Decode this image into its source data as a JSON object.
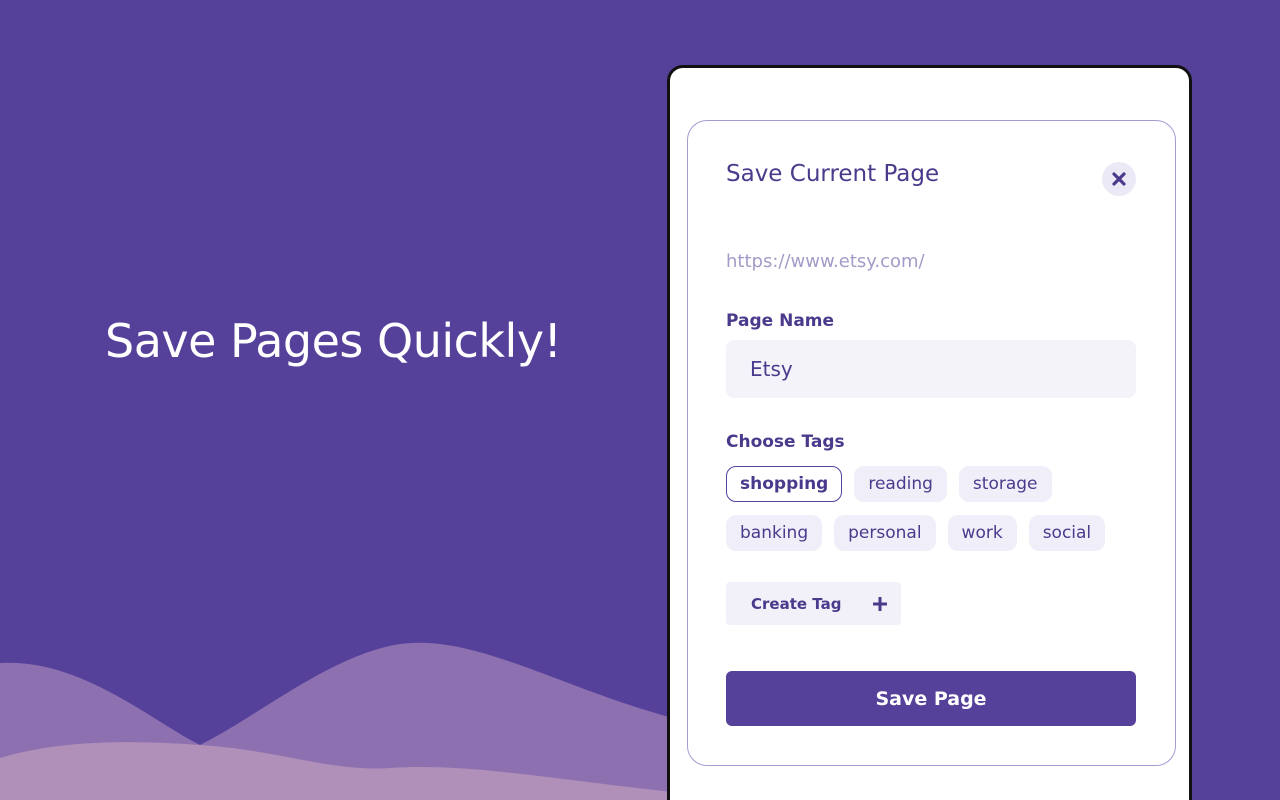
{
  "hero": {
    "headline": "Save Pages Quickly!"
  },
  "popup": {
    "title": "Save Current Page",
    "url": "https://www.etsy.com/",
    "page_name_label": "Page Name",
    "page_name_value": "Etsy",
    "tags_label": "Choose Tags",
    "tags": [
      {
        "label": "shopping",
        "selected": true
      },
      {
        "label": "reading",
        "selected": false
      },
      {
        "label": "storage",
        "selected": false
      },
      {
        "label": "banking",
        "selected": false
      },
      {
        "label": "personal",
        "selected": false
      },
      {
        "label": "work",
        "selected": false
      },
      {
        "label": "social",
        "selected": false
      }
    ],
    "create_tag_label": "Create Tag",
    "save_label": "Save Page"
  },
  "icons": {
    "close": "close-icon",
    "plus": "plus-icon"
  },
  "colors": {
    "background": "#55409a",
    "accent": "#55409a",
    "text_dark": "#4b3a8c",
    "url_muted": "#a49bc8",
    "input_bg": "#f4f3fa",
    "tag_bg": "#f0eef8",
    "wave_front": "#b08fb8",
    "wave_back": "#8d70b0"
  }
}
